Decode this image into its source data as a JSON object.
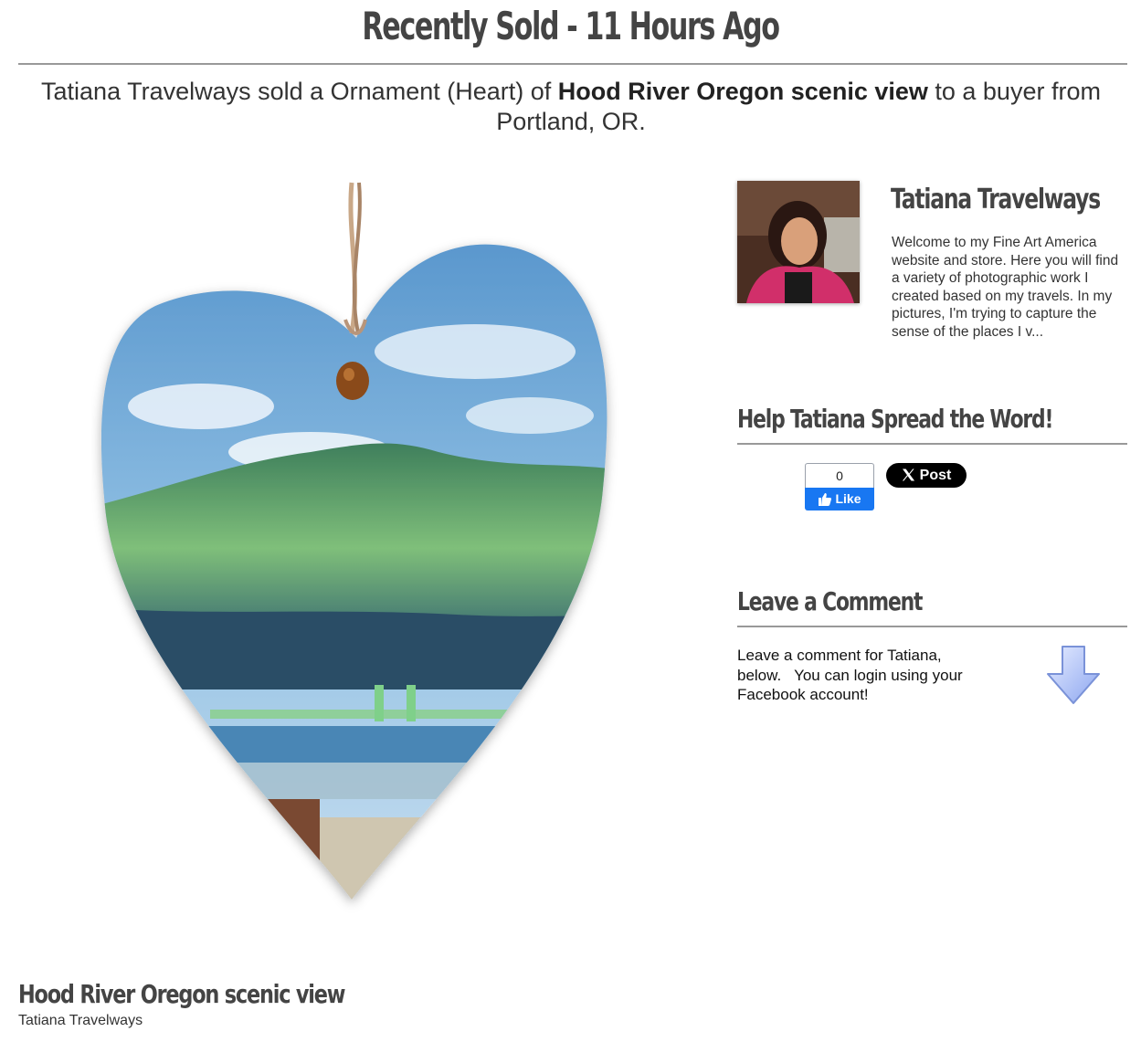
{
  "header": {
    "title": "Recently Sold - 11 Hours Ago"
  },
  "sale": {
    "prefix": "Tatiana Travelways sold a Ornament (Heart) of ",
    "artwork_title": "Hood River Oregon scenic view",
    "suffix": " to a buyer from Portland, OR."
  },
  "product": {
    "image_icon": "heart-ornament-image",
    "title": "Hood River Oregon scenic view",
    "artist": "Tatiana Travelways"
  },
  "artist_panel": {
    "name": "Tatiana Travelways",
    "bio": "Welcome to my Fine Art America website and store. Here you will find a variety of photographic work I created based on my travels. In my pictures, I'm trying to capture the sense of the places I v..."
  },
  "share": {
    "heading": "Help Tatiana Spread the Word!",
    "like_count": "0",
    "like_label": "Like",
    "post_label": "Post",
    "facebook_color": "#1877f2"
  },
  "comment": {
    "heading": "Leave a Comment",
    "text": "Leave a comment for Tatiana,\nbelow.   You can login using your\nFacebook account!"
  }
}
